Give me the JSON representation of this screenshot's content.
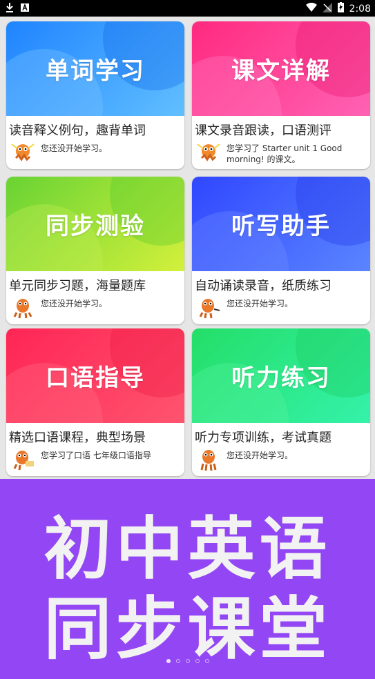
{
  "status_bar": {
    "time": "2:08",
    "left_icons": [
      "download-icon",
      "a-icon"
    ],
    "right_icons": [
      "wifi-icon",
      "no-signal-icon",
      "battery-charging-icon"
    ]
  },
  "cards": [
    {
      "title": "单词学习",
      "desc": "读音释义例句，趣背单词",
      "status": "您还没开始学习。",
      "color_from": "#2f8cff",
      "color_to": "#5ab8ff"
    },
    {
      "title": "课文详解",
      "desc": "课文录音跟读，口语测评",
      "status": "您学习了 Starter unit 1 Good morning! 的课文。",
      "color_from": "#ff2f86",
      "color_to": "#ff5fb0"
    },
    {
      "title": "同步测验",
      "desc": "单元同步习题，海量题库",
      "status": "您还没开始学习。",
      "color_from": "#7ad93a",
      "color_to": "#c7ef3b"
    },
    {
      "title": "听写助手",
      "desc": "自动诵读录音，纸质练习",
      "status": "您还没开始学习。",
      "color_from": "#3b4fff",
      "color_to": "#4f7bff"
    },
    {
      "title": "口语指导",
      "desc": "精选口语课程，典型场景",
      "status": "您学习了口语 七年级口语指导",
      "color_from": "#ff2c56",
      "color_to": "#ff4f6d"
    },
    {
      "title": "听力练习",
      "desc": "听力专项训练，考试真题",
      "status": "您还没开始学习。",
      "color_from": "#2fe36f",
      "color_to": "#35f0a2"
    }
  ],
  "promo": {
    "line1": "初中英语",
    "line2": "同步课堂",
    "background": "#9346f3"
  },
  "pagination": {
    "count": 5,
    "active_index": 0
  }
}
